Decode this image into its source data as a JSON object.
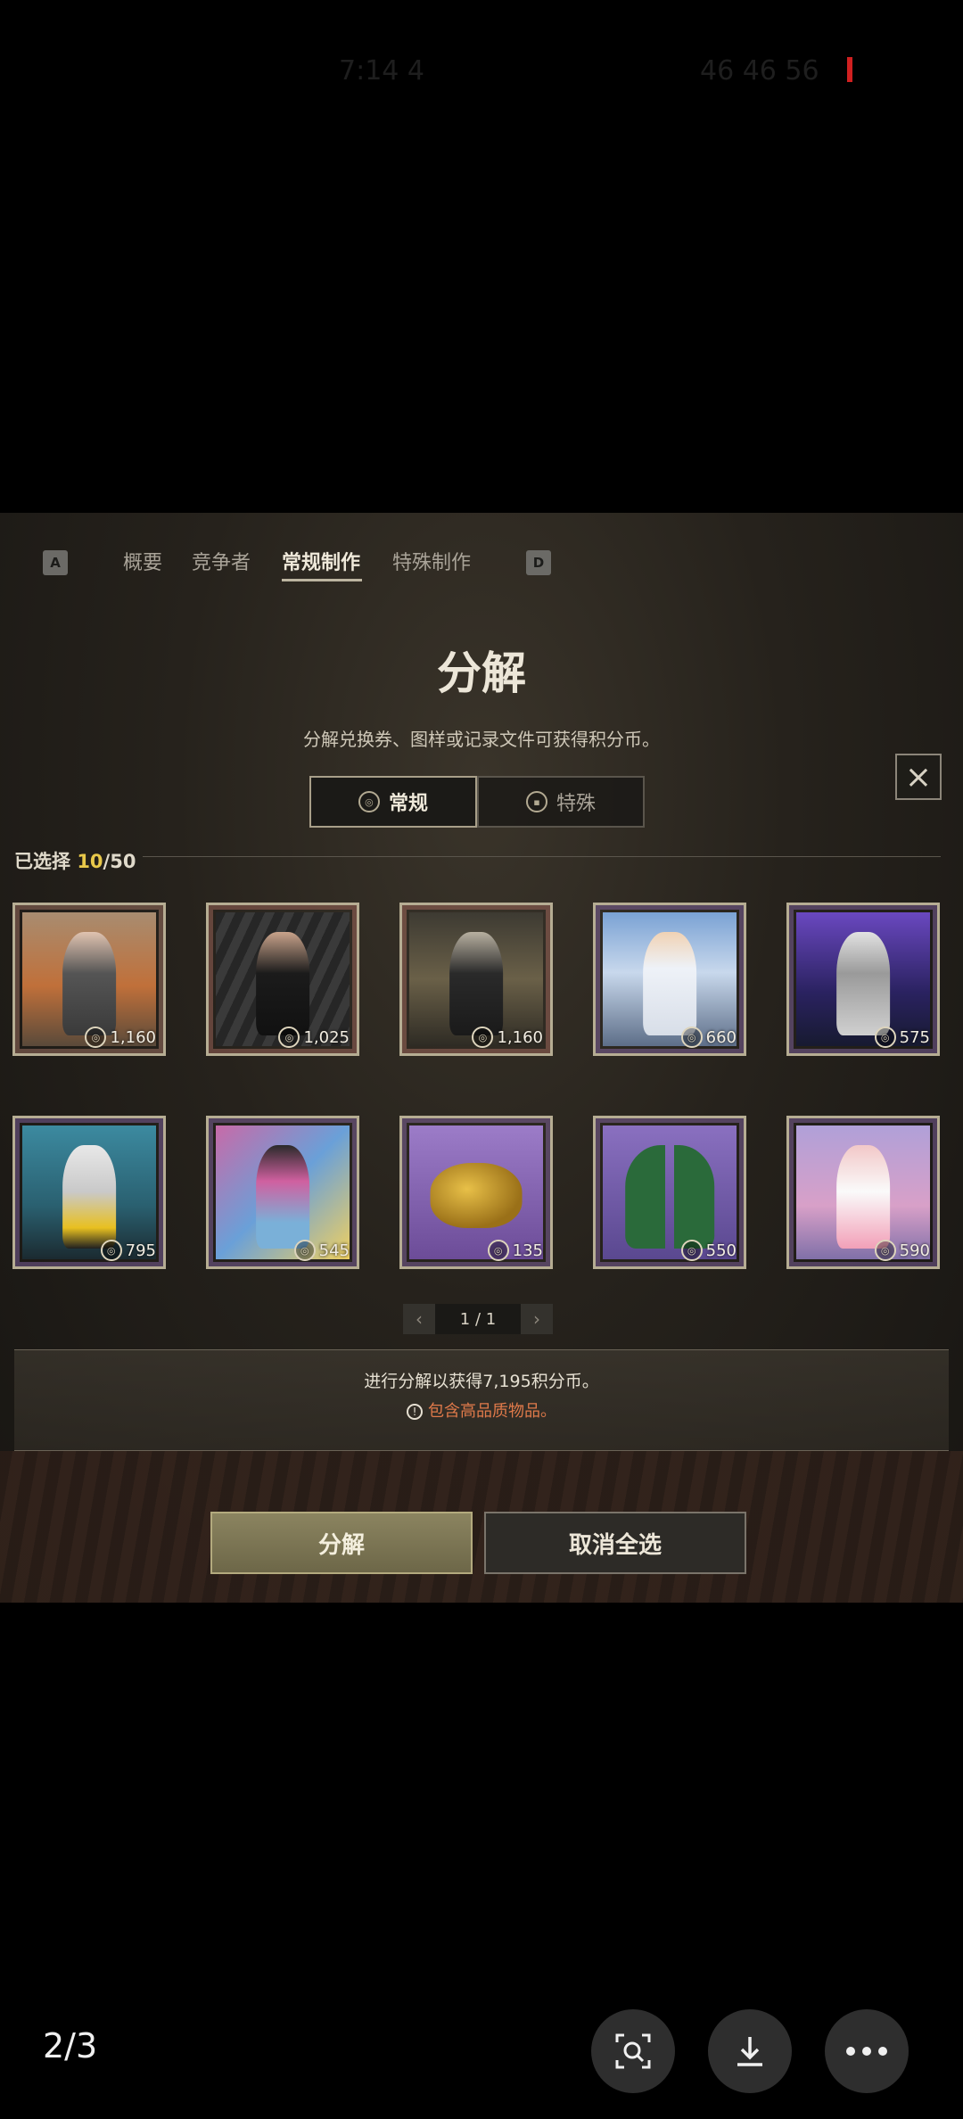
{
  "statusbar": {
    "left_text": "7:14 4",
    "right_text": "46 46 56"
  },
  "nav": {
    "key_left": "A",
    "key_right": "D",
    "tabs": [
      {
        "label": "概要"
      },
      {
        "label": "竞争者"
      },
      {
        "label": "常规制作"
      },
      {
        "label": "特殊制作"
      }
    ],
    "active_tab": "常规制作"
  },
  "panel": {
    "title": "分解",
    "subtitle": "分解兑换券、图样或记录文件可获得积分币。",
    "close_icon": "×"
  },
  "segment": {
    "options": [
      {
        "label": "常规",
        "icon": "coin-icon"
      },
      {
        "label": "特殊",
        "icon": "chip-icon"
      }
    ],
    "selected": "常规"
  },
  "selection": {
    "label": "已选择",
    "count": "10",
    "total": "/50"
  },
  "items": [
    {
      "name": "outfit-gray-dress",
      "price": "1,160",
      "rarity_color": "#e8a18a"
    },
    {
      "name": "outfit-black-dress",
      "price": "1,025",
      "rarity_color": "#e08a7c"
    },
    {
      "name": "outfit-corridor",
      "price": "1,160",
      "rarity_color": "#e08a7c"
    },
    {
      "name": "outfit-white-gown",
      "price": "660",
      "rarity_color": "#b586e6"
    },
    {
      "name": "outfit-white-suit",
      "price": "575",
      "rarity_color": "#b586e6"
    },
    {
      "name": "outfit-crop-top",
      "price": "795",
      "rarity_color": "#b586e6"
    },
    {
      "name": "outfit-pink-jacket",
      "price": "545",
      "rarity_color": "#b586e6"
    },
    {
      "name": "gold-mask",
      "price": "135",
      "rarity_color": "#b586e6"
    },
    {
      "name": "outfit-green-coat",
      "price": "550",
      "rarity_color": "#b586e6"
    },
    {
      "name": "outfit-bunny",
      "price": "590",
      "rarity_color": "#b586e6"
    }
  ],
  "pager": {
    "text": "1 / 1",
    "prev": "‹",
    "next": "›"
  },
  "summary": {
    "gain_text": "进行分解以获得7,195积分币。",
    "warning_text": "包含高品质物品。",
    "warning_icon": "!"
  },
  "buttons": {
    "decompose": "分解",
    "deselect_all": "取消全选"
  },
  "viewer": {
    "page_indicator": "2/3"
  }
}
